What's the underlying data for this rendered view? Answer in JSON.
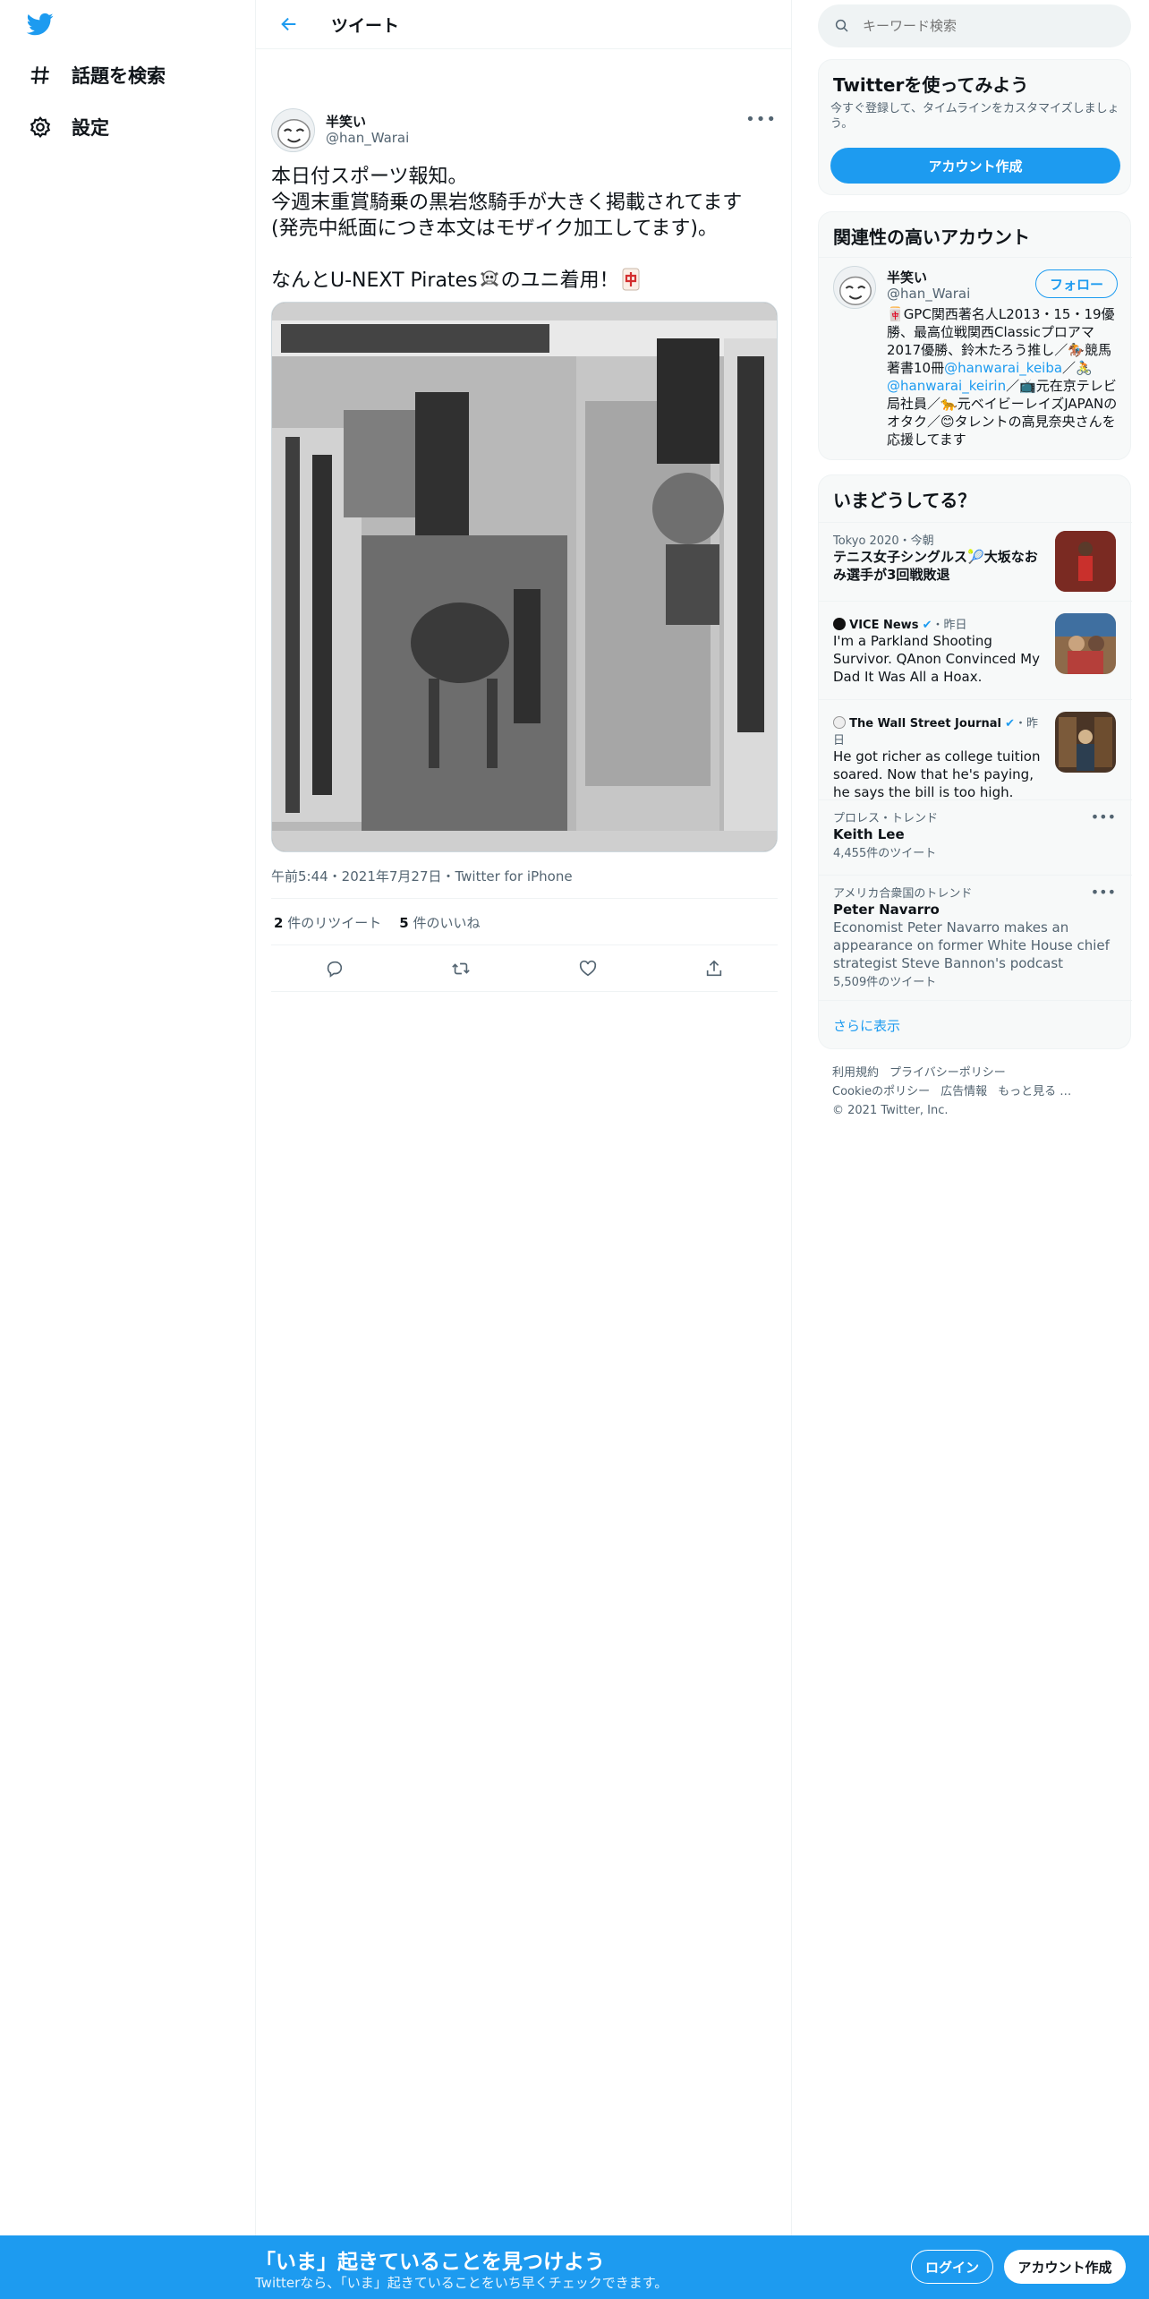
{
  "nav": {
    "logo": "twitter-bird-icon",
    "items": [
      {
        "label": "話題を検索",
        "icon": "hashtag-icon"
      },
      {
        "label": "設定",
        "icon": "gear-icon"
      }
    ]
  },
  "header": {
    "title": "ツイート"
  },
  "tweet": {
    "name": "半笑い",
    "handle": "@han_Warai",
    "text_lines": [
      "本日付スポーツ報知。",
      "今週末重賞騎乗の黒岩悠騎手が大きく掲載されてます",
      "(発売中紙面につき本文はモザイク加工してます)。"
    ],
    "text_last_before": "なんとU-NEXT Pirates",
    "text_last_mid": "のユニ着用！",
    "timestamp": "午前5:44・2021年7月27日・Twitter for iPhone",
    "retweets_count": "2",
    "retweets_label": "件のリツイート",
    "likes_count": "5",
    "likes_label": "件のいいね"
  },
  "search": {
    "placeholder": "キーワード検索"
  },
  "signup_card": {
    "title": "Twitterを使ってみよう",
    "subtitle": "今すぐ登録して、タイムラインをカスタマイズしましょう。",
    "button": "アカウント作成"
  },
  "related": {
    "title": "関連性の高いアカウント",
    "name": "半笑い",
    "handle": "@han_Warai",
    "follow": "フォロー",
    "bio_1": "GPC関西著名人L2013・15・19優勝、最高位戦関西Classicプロアマ2017優勝、鈴木たろう推し／",
    "bio_2": "競馬著書10冊",
    "bio_link1": "@hanwarai_keiba",
    "bio_3": "／",
    "bio_link2": "@hanwarai_keirin",
    "bio_4": "／",
    "bio_5": "元在京テレビ局社員／",
    "bio_6": "元ベイビーレイズJAPANのオタク／",
    "bio_7": "タレントの高見奈央さんを応援してます"
  },
  "trends": {
    "title": "いまどうしてる？",
    "items": [
      {
        "meta": "Tokyo 2020・今朝",
        "title_a": "テニス女子シングルス",
        "title_b": "大坂なおみ選手が3回戦敗退"
      },
      {
        "source": "VICE News",
        "when": "・昨日",
        "title": "I'm a Parkland Shooting Survivor. QAnon Convinced My Dad It Was All a Hoax."
      },
      {
        "source": "The Wall Street Journal",
        "when": "・昨日",
        "title": "He got richer as college tuition soared. Now that he's paying, he says the bill is too high."
      },
      {
        "meta": "プロレス・トレンド",
        "title": "Keith Lee",
        "count": "4,455件のツイート"
      },
      {
        "meta": "アメリカ合衆国のトレンド",
        "title": "Peter Navarro",
        "desc": "Economist Peter Navarro makes an appearance on former White House chief strategist Steve Bannon's podcast",
        "count": "5,509件のツイート"
      }
    ],
    "show_more": "さらに表示"
  },
  "footer": {
    "terms": "利用規約",
    "privacy": "プライバシーポリシー",
    "cookie": "Cookieのポリシー",
    "ads": "広告情報",
    "more": "もっと見る …",
    "copyright": "© 2021 Twitter, Inc."
  },
  "banner": {
    "title": "「いま」起きていることを見つけよう",
    "subtitle": "Twitterなら、「いま」起きていることをいち早くチェックできます。",
    "login": "ログイン",
    "signup": "アカウント作成"
  },
  "colors": {
    "accent": "#1d9bf0",
    "text": "#0f1419",
    "muted": "#536471"
  }
}
